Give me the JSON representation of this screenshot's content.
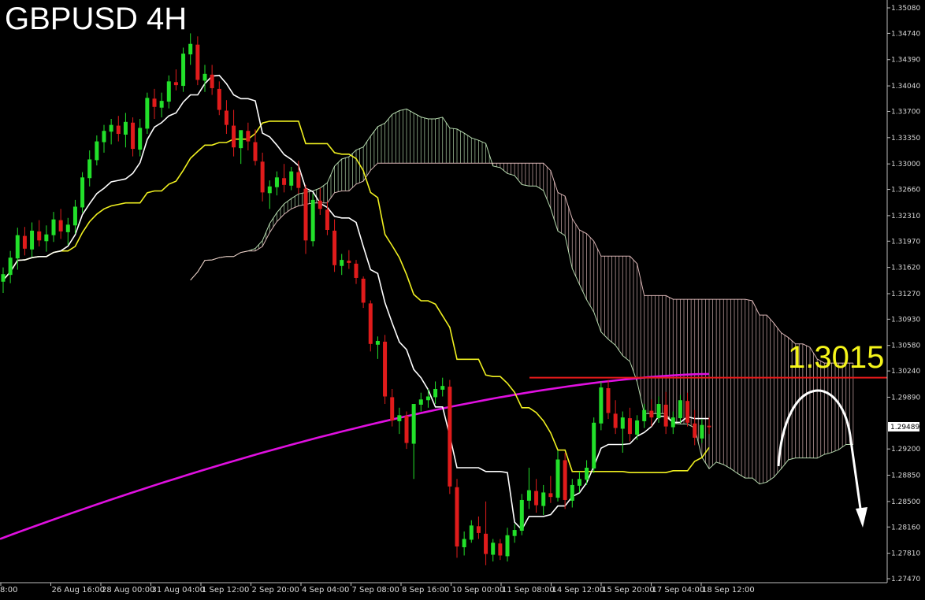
{
  "header": {
    "title": "GBPUSD 4H"
  },
  "annotation": {
    "level_label": "1.3015"
  },
  "chart_data": {
    "type": "candlestick",
    "symbol": "GBPUSD",
    "timeframe": "4H",
    "ylim": [
      1.2747,
      1.3508
    ],
    "y_ticks": [
      "1.35080",
      "1.34740",
      "1.34390",
      "1.34040",
      "1.33700",
      "1.33350",
      "1.33000",
      "1.32660",
      "1.32310",
      "1.31970",
      "1.31620",
      "1.31270",
      "1.30930",
      "1.30580",
      "1.30240",
      "1.29890",
      "1.29200",
      "1.28850",
      "1.28500",
      "1.28160",
      "1.27810",
      "1.27470"
    ],
    "x_ticks": [
      "8:00",
      "26 Aug 16:00",
      "28 Aug 00:00",
      "31 Aug 04:00",
      "1 Sep 12:00",
      "2 Sep 20:00",
      "4 Sep 04:00",
      "7 Sep 08:00",
      "8 Sep 16:00",
      "10 Sep 00:00",
      "11 Sep 08:00",
      "14 Sep 12:00",
      "15 Sep 20:00",
      "17 Sep 04:00",
      "18 Sep 12:00"
    ],
    "current_price": "1.29489",
    "resistance_level": 1.3015,
    "colors": {
      "background": "#000000",
      "bull_candle": "#22e02a",
      "bear_candle": "#e01b1b",
      "tenkan": "#ffffff",
      "kijun": "#f0f020",
      "ma": "#e010e0",
      "level_line": "#e81a1a",
      "level_text": "#f5f51a",
      "cloud_bull": "#c8f0c0",
      "cloud_bear": "#f0c8c8",
      "forecast_arrow": "#ffffff"
    },
    "ohlc": [
      [
        1.3143,
        1.3162,
        1.3128,
        1.3153
      ],
      [
        1.3152,
        1.3184,
        1.3141,
        1.3175
      ],
      [
        1.3174,
        1.3215,
        1.3159,
        1.3205
      ],
      [
        1.3204,
        1.3216,
        1.3178,
        1.3187
      ],
      [
        1.3186,
        1.3222,
        1.3176,
        1.3211
      ],
      [
        1.321,
        1.3225,
        1.319,
        1.3198
      ],
      [
        1.3197,
        1.3218,
        1.3183,
        1.3206
      ],
      [
        1.3205,
        1.3236,
        1.3196,
        1.3226
      ],
      [
        1.3225,
        1.324,
        1.32,
        1.321
      ],
      [
        1.3209,
        1.3228,
        1.3192,
        1.3219
      ],
      [
        1.3218,
        1.3252,
        1.3207,
        1.3243
      ],
      [
        1.3242,
        1.3289,
        1.3235,
        1.3282
      ],
      [
        1.3281,
        1.3318,
        1.327,
        1.3306
      ],
      [
        1.3305,
        1.3338,
        1.3298,
        1.333
      ],
      [
        1.3329,
        1.3352,
        1.3315,
        1.3344
      ],
      [
        1.3343,
        1.336,
        1.3326,
        1.3352
      ],
      [
        1.3351,
        1.3364,
        1.333,
        1.334
      ],
      [
        1.3339,
        1.3368,
        1.3322,
        1.3356
      ],
      [
        1.3355,
        1.3362,
        1.331,
        1.332
      ],
      [
        1.3319,
        1.336,
        1.331,
        1.3348
      ],
      [
        1.3347,
        1.3395,
        1.334,
        1.3388
      ],
      [
        1.3387,
        1.34,
        1.336,
        1.3376
      ],
      [
        1.3375,
        1.3395,
        1.3362,
        1.3384
      ],
      [
        1.3383,
        1.3418,
        1.3374,
        1.341
      ],
      [
        1.3409,
        1.3426,
        1.3398,
        1.3405
      ],
      [
        1.3404,
        1.3455,
        1.3396,
        1.3447
      ],
      [
        1.3446,
        1.3474,
        1.3432,
        1.346
      ],
      [
        1.3459,
        1.347,
        1.3405,
        1.3412
      ],
      [
        1.3411,
        1.3432,
        1.3396,
        1.342
      ],
      [
        1.3419,
        1.3432,
        1.3392,
        1.3401
      ],
      [
        1.34,
        1.341,
        1.3365,
        1.3372
      ],
      [
        1.3371,
        1.3385,
        1.334,
        1.3352
      ],
      [
        1.3351,
        1.3372,
        1.331,
        1.3322
      ],
      [
        1.3321,
        1.3338,
        1.33,
        1.3345
      ],
      [
        1.3344,
        1.3355,
        1.3318,
        1.333
      ],
      [
        1.3329,
        1.3346,
        1.3298,
        1.3304
      ],
      [
        1.3303,
        1.3315,
        1.325,
        1.3262
      ],
      [
        1.3261,
        1.3278,
        1.324,
        1.327
      ],
      [
        1.3269,
        1.329,
        1.3258,
        1.3282
      ],
      [
        1.3281,
        1.33,
        1.3262,
        1.3272
      ],
      [
        1.3271,
        1.3296,
        1.3265,
        1.329
      ],
      [
        1.3289,
        1.3304,
        1.326,
        1.3268
      ],
      [
        1.3267,
        1.3272,
        1.318,
        1.3198
      ],
      [
        1.3197,
        1.326,
        1.319,
        1.3252
      ],
      [
        1.3251,
        1.3268,
        1.3232,
        1.324
      ],
      [
        1.3239,
        1.325,
        1.3205,
        1.3212
      ],
      [
        1.3211,
        1.3226,
        1.3156,
        1.3165
      ],
      [
        1.3164,
        1.318,
        1.3152,
        1.3172
      ],
      [
        1.3171,
        1.3185,
        1.316,
        1.3168
      ],
      [
        1.3167,
        1.3172,
        1.314,
        1.3148
      ],
      [
        1.3147,
        1.315,
        1.3108,
        1.3115
      ],
      [
        1.3114,
        1.3118,
        1.305,
        1.306
      ],
      [
        1.3059,
        1.307,
        1.304,
        1.3064
      ],
      [
        1.3063,
        1.3072,
        1.298,
        1.299
      ],
      [
        1.2989,
        1.3,
        1.295,
        1.2958
      ],
      [
        1.2957,
        1.2975,
        1.294,
        1.2965
      ],
      [
        1.2964,
        1.297,
        1.292,
        1.2928
      ],
      [
        1.2927,
        1.2935,
        1.288,
        1.298
      ],
      [
        1.2979,
        1.2995,
        1.297,
        1.2986
      ],
      [
        1.2985,
        1.3,
        1.2975,
        1.299
      ],
      [
        1.2989,
        1.301,
        1.298,
        1.3
      ],
      [
        1.2999,
        1.3015,
        1.299,
        1.3004
      ],
      [
        1.3003,
        1.3012,
        1.286,
        1.287
      ],
      [
        1.2869,
        1.288,
        1.2775,
        1.279
      ],
      [
        1.2789,
        1.281,
        1.2778,
        1.28
      ],
      [
        1.2799,
        1.2825,
        1.2795,
        1.2818
      ],
      [
        1.2817,
        1.283,
        1.28,
        1.2808
      ],
      [
        1.2807,
        1.285,
        1.2765,
        1.278
      ],
      [
        1.2779,
        1.28,
        1.277,
        1.2795
      ],
      [
        1.2794,
        1.28,
        1.2772,
        1.2778
      ],
      [
        1.2777,
        1.2815,
        1.277,
        1.2805
      ],
      [
        1.2804,
        1.282,
        1.2795,
        1.2812
      ],
      [
        1.2811,
        1.286,
        1.2805,
        1.2852
      ],
      [
        1.2851,
        1.2895,
        1.284,
        1.2865
      ],
      [
        1.2864,
        1.288,
        1.2835,
        1.2845
      ],
      [
        1.2844,
        1.2872,
        1.2832,
        1.2862
      ],
      [
        1.2861,
        1.2884,
        1.2848,
        1.2856
      ],
      [
        1.2855,
        1.2918,
        1.285,
        1.2906
      ],
      [
        1.2905,
        1.2915,
        1.284,
        1.2852
      ],
      [
        1.2851,
        1.288,
        1.2842,
        1.2872
      ],
      [
        1.2871,
        1.289,
        1.2862,
        1.288
      ],
      [
        1.2879,
        1.2905,
        1.2872,
        1.2895
      ],
      [
        1.2894,
        1.2962,
        1.2888,
        1.2955
      ],
      [
        1.2954,
        1.301,
        1.2945,
        1.3002
      ],
      [
        1.3001,
        1.3012,
        1.296,
        1.2968
      ],
      [
        1.2967,
        1.2985,
        1.294,
        1.2948
      ],
      [
        1.2947,
        1.297,
        1.2915,
        1.2962
      ],
      [
        1.2961,
        1.2975,
        1.293,
        1.294
      ],
      [
        1.2939,
        1.2965,
        1.2932,
        1.2958
      ],
      [
        1.2957,
        1.298,
        1.2948,
        1.2972
      ],
      [
        1.2971,
        1.2986,
        1.295,
        1.2962
      ],
      [
        1.2961,
        1.299,
        1.2955,
        1.298
      ],
      [
        1.2979,
        1.2996,
        1.294,
        1.295
      ],
      [
        1.2949,
        1.297,
        1.294,
        1.2962
      ],
      [
        1.2961,
        1.2992,
        1.2955,
        1.2985
      ],
      [
        1.2984,
        1.2995,
        1.295,
        1.2955
      ],
      [
        1.2954,
        1.2972,
        1.2925,
        1.2935
      ],
      [
        1.2934,
        1.296,
        1.2928,
        1.2952
      ],
      [
        1.2951,
        1.2962,
        1.294,
        1.2949
      ]
    ],
    "forecast": "arc up to cloud then down, arrow pointing down"
  }
}
